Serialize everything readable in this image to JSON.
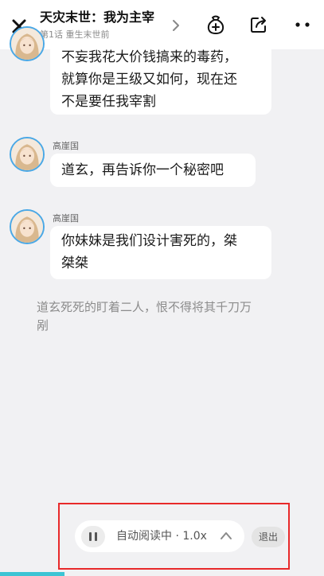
{
  "header": {
    "title": "天灾末世：我为主宰",
    "subtitle": "第1话 重生末世前",
    "icons": [
      "close-icon",
      "chevron-right-icon",
      "gift-bag-icon",
      "share-icon",
      "more-icon"
    ]
  },
  "chat": {
    "messages": [
      {
        "speaker": "",
        "lines": [
          "不妄我花大价钱搞来的毒药，",
          "就算你是王级又如何，现在还",
          "不是要任我宰割"
        ]
      },
      {
        "speaker": "高崖国",
        "lines": [
          "道玄，再告诉你一个秘密吧"
        ]
      },
      {
        "speaker": "高崖国",
        "lines": [
          "你妹妹是我们设计害死的，桀",
          "桀桀"
        ]
      }
    ],
    "narration": [
      "道玄死死的盯着二人，恨不得将其千刀万",
      "剐"
    ]
  },
  "player": {
    "status": "自动阅读中 · 1.0x",
    "exit_label": "退出",
    "progress": 0.2
  },
  "colors": {
    "accent": "#3cc4d4",
    "highlight": "#e8292a",
    "avatar_ring": "#4aa8e6",
    "background": "#f1f1f3"
  }
}
